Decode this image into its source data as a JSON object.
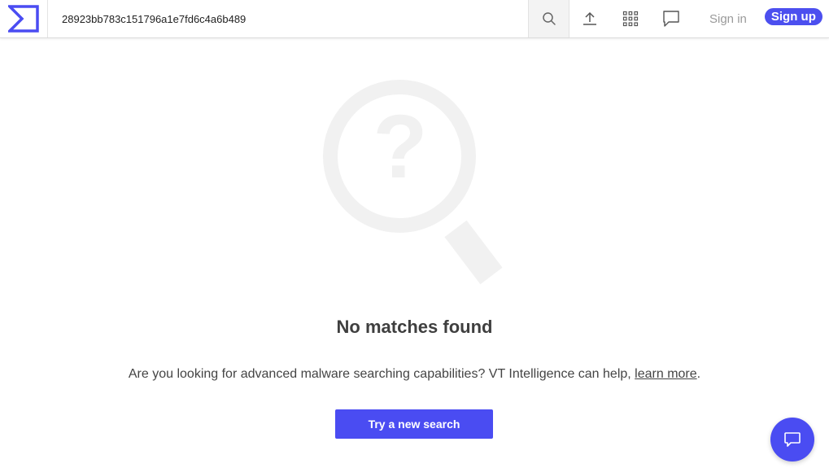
{
  "header": {
    "logo_icon": "virustotal-sigma-logo",
    "search": {
      "value": "28923bb783c151796a1e7fd6c4a6b489",
      "placeholder": "",
      "button_icon": "search-icon"
    },
    "tools": [
      {
        "icon": "upload-icon"
      },
      {
        "icon": "apps-grid-icon"
      },
      {
        "icon": "chat-bubble-icon"
      }
    ],
    "signin_label": "Sign in",
    "signup_label": "Sign up"
  },
  "main": {
    "illustration_icon": "question-magnifier-icon",
    "title": "No matches found",
    "message_prefix": "Are you looking for advanced malware searching capabilities? VT Intelligence can help, ",
    "message_link": "learn more",
    "message_suffix": ".",
    "cta_label": "Try a new search"
  },
  "chat_widget": {
    "icon": "chat-icon"
  },
  "colors": {
    "accent": "#4a4cf2",
    "illustration": "#f1f1f1",
    "text": "#3f3f3f"
  }
}
